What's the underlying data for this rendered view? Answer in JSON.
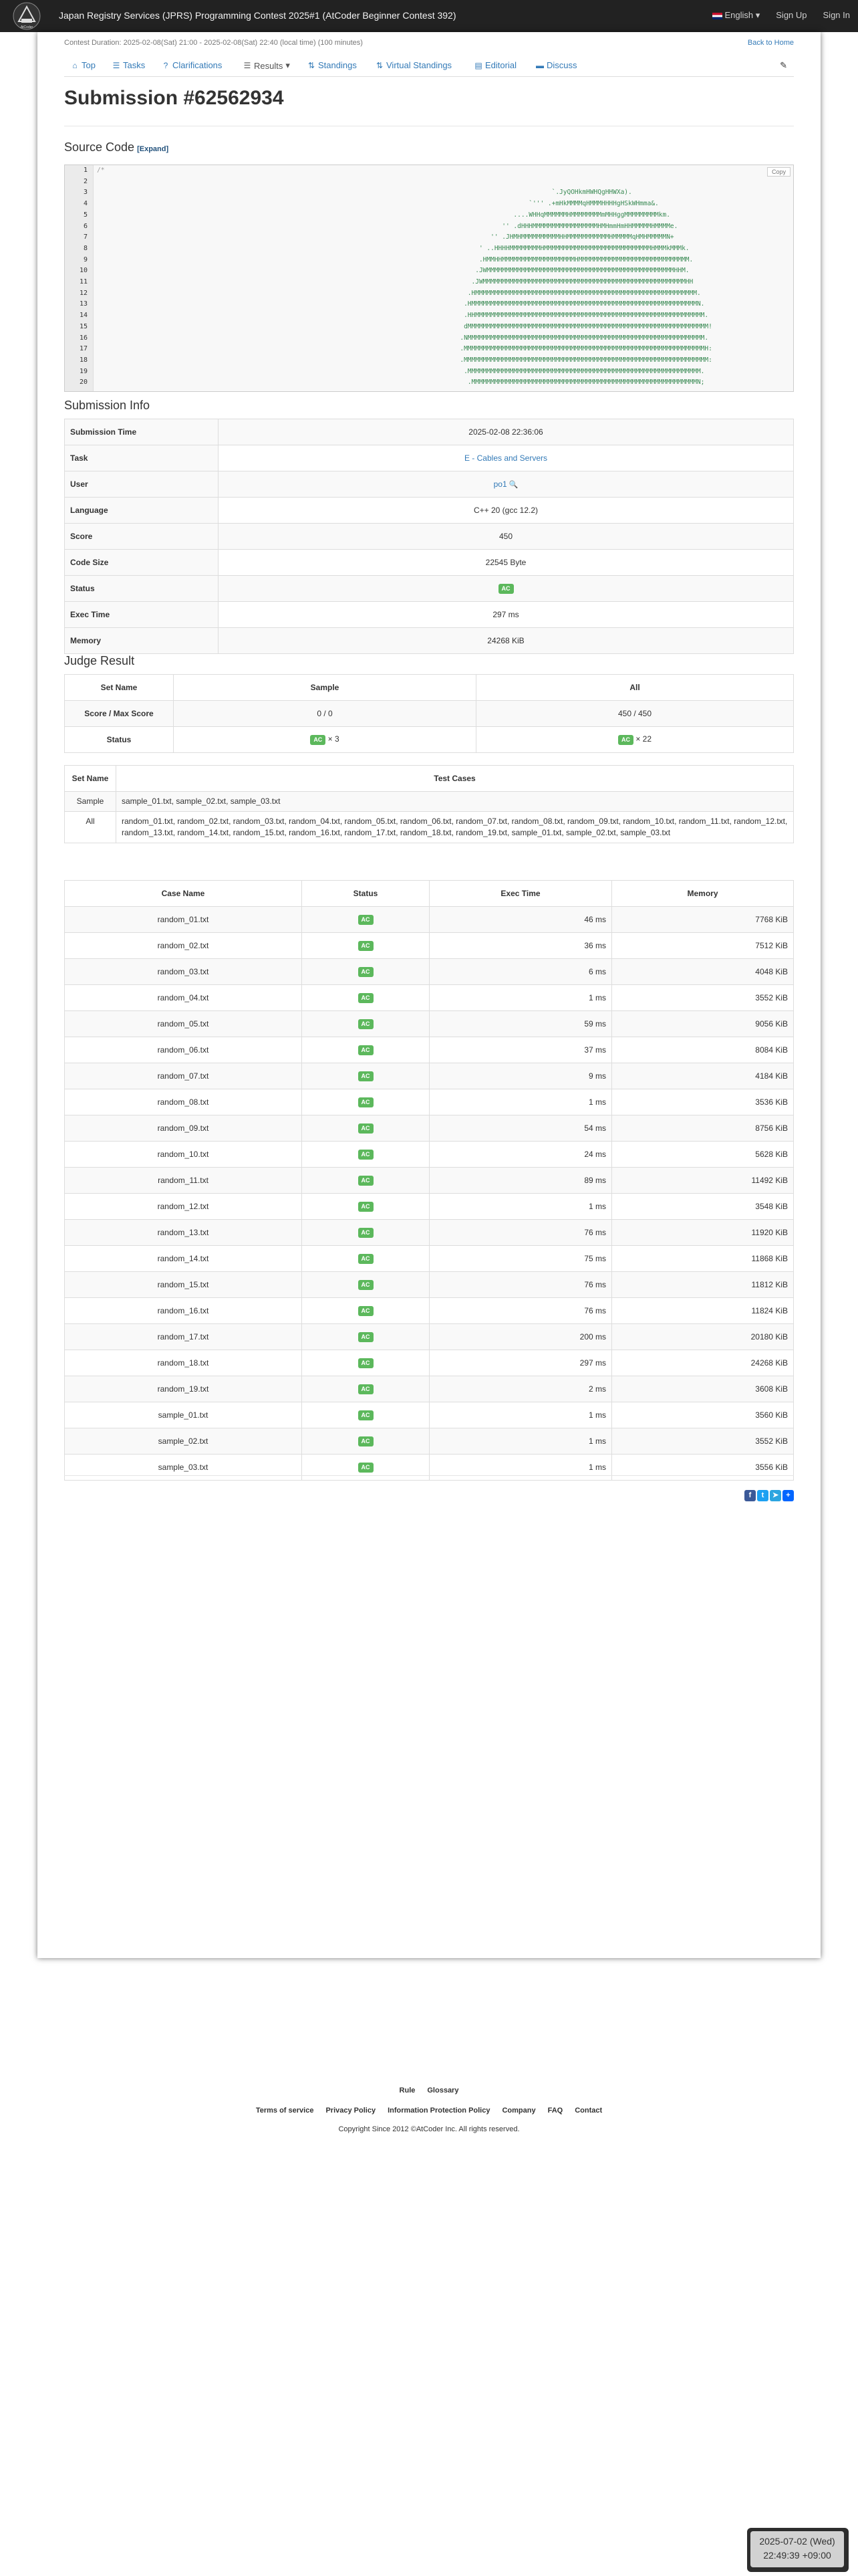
{
  "header": {
    "brand": "Japan Registry Services (JPRS) Programming Contest 2025#1 (AtCoder Beginner Contest 392)",
    "language": "English",
    "sign_up": "Sign Up",
    "sign_in": "Sign In",
    "logo_text": "AtCoder"
  },
  "contest": {
    "duration": "Contest Duration: 2025-02-08(Sat) 21:00 - 2025-02-08(Sat) 22:40 (local time) (100 minutes)",
    "back_home": "Back to Home"
  },
  "tabs": [
    {
      "label": "Top",
      "icon": "home-icon"
    },
    {
      "label": "Tasks",
      "icon": "list-icon"
    },
    {
      "label": "Clarifications",
      "icon": "question-icon"
    },
    {
      "label": "Results",
      "icon": "list-icon"
    },
    {
      "label": "Standings",
      "icon": "sort-icon"
    },
    {
      "label": "Virtual Standings",
      "icon": "sort-icon"
    },
    {
      "label": "Editorial",
      "icon": "book-icon"
    },
    {
      "label": "Discuss",
      "icon": "comment-icon"
    }
  ],
  "submission": {
    "title": "Submission #62562934"
  },
  "source_code": {
    "heading": "Source Code",
    "expand": "[Expand]",
    "copy": "Copy",
    "lines": [
      "/*",
      "",
      "                                                                                                                       `.JyQOHkmHWHQgHHWXa).",
      "                                                                                                                 `''' .+mHkMMMMqHMMMHHHHgHSkWHmma&.",
      "                                                                                                             ....WHHqMMMMMMHMMMMMMMMmMHHggMMMMMMMMMkm.",
      "                                                                                                          '' .dHHHMMMMMMMMMMMMMMMMMHMHmmHmHHMMMMMHMMMMe.",
      "                                                                                                       '' .JHMHMMMMMMMMMMHHMMMMMMMMMMMHMMMMMqHMHMMMMMN+",
      "                                                                                                    ' ..HHHHMMMMMMMMHMMMMMMMMMMMMMMMMMMMMMMMMMMMMHMMMkMMMk.",
      "                                                                                                    .HMMHHMMMMMMMMMMMMMMMMMMMHMMMMMMMMMMMMMMMMMMMMMMMMMMMMM.",
      "                                                                                                   .JWMMMMMMMMMMMMMMMMMMMMMMMMMMMMMMMMMMMMMMMMMMMMMMMMMHHM.",
      "                                                                                                  .JWMMMMMMMMMMMMMMMMMMMMMMMMMMMMMMMMMMMMMMMMMMMMMMMMMMMMMHH",
      "                                                                                                 .HMMMMMMMMMMMMMMMMMMMMMMMMMMMMMMMMMMMMMMMMMMMMMMMMMMMMMMMMMM.",
      "                                                                                                .HMMMMMMMMMMMMMMMMMMMMMMMMMMMMMMMMMMMMMMMMMMMMMMMMMMMMMMMMMMMN.",
      "                                                                                                .HHMMMMMMMMMMMMMMMMMMMMMMMMMMMMMMMMMMMMMMMMMMMMMMMMMMMMMMMMMMMM.",
      "                                                                                                dMMMMMMMMMMMMMMMMMMMMMMMMMMMMMMMMMMMMMMMMMMMMMMMMMMMMMMMMMMMMMMM!",
      "                                                                                               .NMMMMMMMMMMMMMMMMMMMMMMMMMMMMMMMMMMMMMMMMMMMMMMMMMMMMMMMMMMMMMM.",
      "                                                                                               .MMMMMMMMMMMMMMMMMMMMMMMMMMMMMMMMMMMMMMMMMMMMMMMMMMMMMMMMMMMMMMMH:",
      "                                                                                               .MMMMMMMMMMMMMMMMMMMMMMMMMMMMMMMMMMMMMMMMMMMMMMMMMMMMMMMMMMMMMMMM:",
      "                                                                                                .MMMMMMMMMMMMMMMMMMMMMMMMMMMMMMMMMMMMMMMMMMMMMMMMMMMMMMMMMMMMM.",
      "                                                                                                 .MMMMMMMMMMMMMMMMMMMMMMMMMMMMMMMMMMMMMMMMMMMMMMMMMMMMMMMMMMMN;"
    ]
  },
  "submission_info": {
    "heading": "Submission Info",
    "rows": [
      {
        "key": "Submission Time",
        "value": "2025-02-08 22:36:06"
      },
      {
        "key": "Task",
        "value": "E - Cables and Servers"
      },
      {
        "key": "User",
        "value": "po1"
      },
      {
        "key": "Language",
        "value": "C++ 20 (gcc 12.2)"
      },
      {
        "key": "Score",
        "value": "450"
      },
      {
        "key": "Code Size",
        "value": "22545 Byte"
      },
      {
        "key": "Status",
        "value": "AC"
      },
      {
        "key": "Exec Time",
        "value": "297 ms"
      },
      {
        "key": "Memory",
        "value": "24268 KiB"
      }
    ]
  },
  "judge_result": {
    "heading": "Judge Result",
    "head": [
      "Set Name",
      "Sample",
      "All"
    ],
    "score_label": "Score / Max Score",
    "score_sample": "0 / 0",
    "score_all": "450 / 450",
    "status_label": "Status",
    "status_sample_badge": "AC",
    "status_sample_count": "× 3",
    "status_all_badge": "AC",
    "status_all_count": "× 22"
  },
  "test_sets": {
    "head": [
      "Set Name",
      "Test Cases"
    ],
    "rows": [
      {
        "name": "Sample",
        "cases": "sample_01.txt, sample_02.txt, sample_03.txt"
      },
      {
        "name": "All",
        "cases": "random_01.txt, random_02.txt, random_03.txt, random_04.txt, random_05.txt, random_06.txt, random_07.txt, random_08.txt, random_09.txt, random_10.txt, random_11.txt, random_12.txt, random_13.txt, random_14.txt, random_15.txt, random_16.txt, random_17.txt, random_18.txt, random_19.txt, sample_01.txt, sample_02.txt, sample_03.txt"
      }
    ]
  },
  "cases": {
    "head": [
      "Case Name",
      "Status",
      "Exec Time",
      "Memory"
    ],
    "rows": [
      {
        "name": "random_01.txt",
        "status": "AC",
        "time": "46 ms",
        "memory": "7768 KiB"
      },
      {
        "name": "random_02.txt",
        "status": "AC",
        "time": "36 ms",
        "memory": "7512 KiB"
      },
      {
        "name": "random_03.txt",
        "status": "AC",
        "time": "6 ms",
        "memory": "4048 KiB"
      },
      {
        "name": "random_04.txt",
        "status": "AC",
        "time": "1 ms",
        "memory": "3552 KiB"
      },
      {
        "name": "random_05.txt",
        "status": "AC",
        "time": "59 ms",
        "memory": "9056 KiB"
      },
      {
        "name": "random_06.txt",
        "status": "AC",
        "time": "37 ms",
        "memory": "8084 KiB"
      },
      {
        "name": "random_07.txt",
        "status": "AC",
        "time": "9 ms",
        "memory": "4184 KiB"
      },
      {
        "name": "random_08.txt",
        "status": "AC",
        "time": "1 ms",
        "memory": "3536 KiB"
      },
      {
        "name": "random_09.txt",
        "status": "AC",
        "time": "54 ms",
        "memory": "8756 KiB"
      },
      {
        "name": "random_10.txt",
        "status": "AC",
        "time": "24 ms",
        "memory": "5628 KiB"
      },
      {
        "name": "random_11.txt",
        "status": "AC",
        "time": "89 ms",
        "memory": "11492 KiB"
      },
      {
        "name": "random_12.txt",
        "status": "AC",
        "time": "1 ms",
        "memory": "3548 KiB"
      },
      {
        "name": "random_13.txt",
        "status": "AC",
        "time": "76 ms",
        "memory": "11920 KiB"
      },
      {
        "name": "random_14.txt",
        "status": "AC",
        "time": "75 ms",
        "memory": "11868 KiB"
      },
      {
        "name": "random_15.txt",
        "status": "AC",
        "time": "76 ms",
        "memory": "11812 KiB"
      },
      {
        "name": "random_16.txt",
        "status": "AC",
        "time": "76 ms",
        "memory": "11824 KiB"
      },
      {
        "name": "random_17.txt",
        "status": "AC",
        "time": "200 ms",
        "memory": "20180 KiB"
      },
      {
        "name": "random_18.txt",
        "status": "AC",
        "time": "297 ms",
        "memory": "24268 KiB"
      },
      {
        "name": "random_19.txt",
        "status": "AC",
        "time": "2 ms",
        "memory": "3608 KiB"
      },
      {
        "name": "sample_01.txt",
        "status": "AC",
        "time": "1 ms",
        "memory": "3560 KiB"
      },
      {
        "name": "sample_02.txt",
        "status": "AC",
        "time": "1 ms",
        "memory": "3552 KiB"
      },
      {
        "name": "sample_03.txt",
        "status": "AC",
        "time": "1 ms",
        "memory": "3556 KiB"
      }
    ]
  },
  "share_icons": [
    "facebook-icon",
    "twitter-icon",
    "telegram-icon",
    "add-share-icon"
  ],
  "footer": {
    "row1": [
      "Rule",
      "Glossary"
    ],
    "row2": [
      "Terms of service",
      "Privacy Policy",
      "Information Protection Policy",
      "Company",
      "FAQ",
      "Contact"
    ],
    "copyright": "Copyright Since 2012 ©AtCoder Inc. All rights reserved."
  },
  "clock": {
    "date": "2025-07-02 (Wed)",
    "time": "22:49:39 +09:00"
  },
  "colors": {
    "navbar": "#222222",
    "link": "#337ab7",
    "ac_badge": "#5cb85c"
  }
}
